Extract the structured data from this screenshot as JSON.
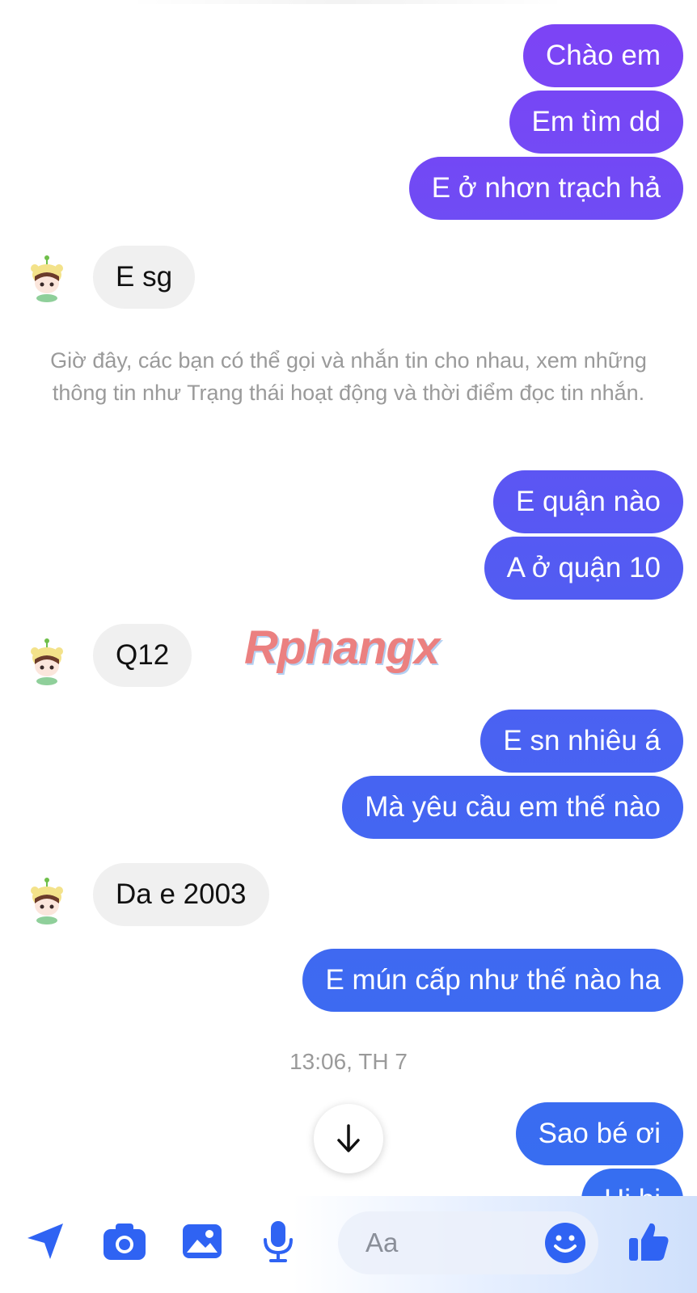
{
  "messages": [
    {
      "id": "m1",
      "dir": "out",
      "text": "Chào em"
    },
    {
      "id": "m2",
      "dir": "out",
      "text": "Em tìm dd"
    },
    {
      "id": "m3",
      "dir": "out",
      "text": "E ở nhơn trạch hả"
    },
    {
      "id": "m4",
      "dir": "in",
      "text": "E sg"
    },
    {
      "id": "m5",
      "dir": "out",
      "text": "E quận nào"
    },
    {
      "id": "m6",
      "dir": "out",
      "text": "A ở quận 10"
    },
    {
      "id": "m7",
      "dir": "in",
      "text": "Q12"
    },
    {
      "id": "m8",
      "dir": "out",
      "text": "E sn nhiêu á"
    },
    {
      "id": "m9",
      "dir": "out",
      "text": "Mà yêu cầu em thế nào"
    },
    {
      "id": "m10",
      "dir": "in",
      "text": "Da e 2003"
    },
    {
      "id": "m11",
      "dir": "out",
      "text": "E mún cấp như thế nào ha"
    },
    {
      "id": "m12",
      "dir": "out",
      "text": "Sao bé ơi"
    },
    {
      "id": "m13",
      "dir": "out",
      "text": "Hi hi"
    }
  ],
  "system_notice": "Giờ đây, các bạn có thể gọi và nhắn tin cho nhau, xem những thông tin như Trạng thái hoạt động và thời điểm đọc tin nhắn.",
  "timestamp": "13:06, TH 7",
  "watermark": "Rphangx",
  "composer": {
    "placeholder": "Aa",
    "icons": [
      "send-location-icon",
      "camera-icon",
      "image-icon",
      "microphone-icon",
      "emoji-icon",
      "thumbs-up-icon"
    ]
  },
  "colors": {
    "bubble_out_top": "#7a45f5",
    "bubble_out_bottom": "#3f67f0",
    "bubble_in": "#f0f0f0",
    "accent": "#2f63f3"
  }
}
